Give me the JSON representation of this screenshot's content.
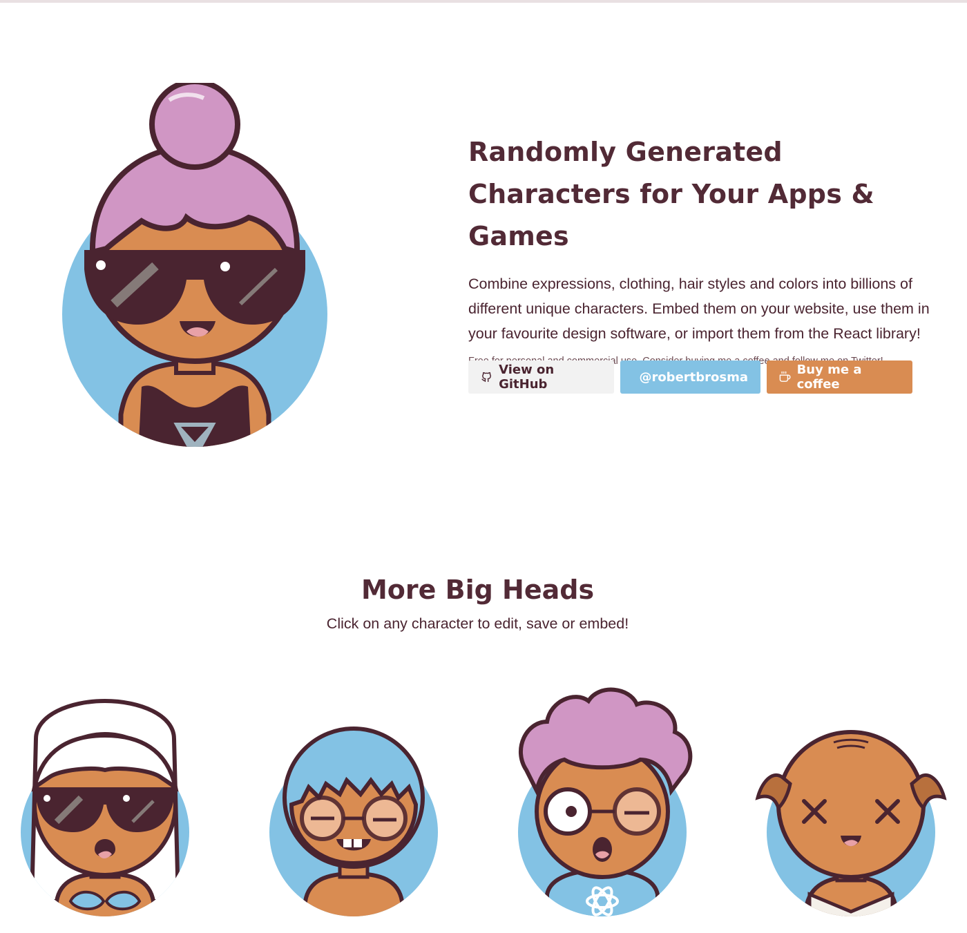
{
  "hero": {
    "title": "Randomly Generated Characters for Your Apps & Games",
    "description": "Combine expressions, clothing, hair styles and colors into billions of different unique characters. Embed them on your website, use them in your favourite design software, or import them from the React library!",
    "note": "Free for personal and commercial use. Consider buying me a coffee and follow me on Twitter!",
    "buttons": {
      "github": {
        "label": "View on GitHub",
        "icon": "github-icon"
      },
      "twitter": {
        "label": "@robertbrosma",
        "icon": "twitter-icon"
      },
      "coffee": {
        "label": "Buy me a coffee",
        "icon": "coffee-icon"
      }
    }
  },
  "more": {
    "title": "More Big Heads",
    "subtitle": "Click on any character to edit, save or embed!"
  },
  "colors": {
    "ink": "#4a2430",
    "skin": "#d98c52",
    "circle": "#83c2e4",
    "pink_hair": "#d096c4",
    "github_btn": "#f2f2f2",
    "twitter_btn": "#83c2e4",
    "coffee_btn": "#d98c52"
  },
  "avatars": [
    {
      "name": "hero-character",
      "hair": "bun-pink",
      "accessory": "sunglasses",
      "clothing": "tank-top"
    },
    {
      "name": "character-1",
      "hair": "long-white",
      "accessory": "sunglasses",
      "clothing": "bikini-top"
    },
    {
      "name": "character-2",
      "hair": "blue-short",
      "accessory": "round-glasses",
      "clothing": "none"
    },
    {
      "name": "character-3",
      "hair": "afro-pink",
      "accessory": "round-glasses",
      "clothing": "react-tshirt"
    },
    {
      "name": "character-4",
      "hair": "bald",
      "accessory": "none",
      "clothing": "dress"
    }
  ]
}
